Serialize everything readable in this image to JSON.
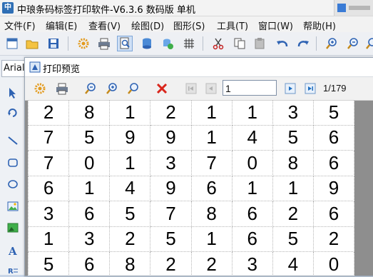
{
  "app": {
    "title": "中琅条码标签打印软件-V6.3.6 数码版 单机",
    "icon_label": "中"
  },
  "menu": [
    "文件(F)",
    "编辑(E)",
    "查看(V)",
    "绘图(D)",
    "图形(S)",
    "工具(T)",
    "窗口(W)",
    "帮助(H)"
  ],
  "font_combo": {
    "value": "Arial"
  },
  "preview": {
    "title": "打印预览",
    "page_input": "1",
    "page_count": "1/179",
    "rows": [
      [
        "2",
        "8",
        "1",
        "2",
        "1",
        "1",
        "3",
        "5"
      ],
      [
        "7",
        "5",
        "9",
        "9",
        "1",
        "4",
        "5",
        "6"
      ],
      [
        "7",
        "0",
        "1",
        "3",
        "7",
        "0",
        "8",
        "6"
      ],
      [
        "6",
        "1",
        "4",
        "9",
        "6",
        "1",
        "1",
        "9"
      ],
      [
        "3",
        "6",
        "5",
        "7",
        "8",
        "6",
        "2",
        "6"
      ],
      [
        "1",
        "3",
        "2",
        "5",
        "1",
        "6",
        "5",
        "2"
      ],
      [
        "5",
        "6",
        "8",
        "2",
        "2",
        "3",
        "4",
        "0"
      ]
    ]
  },
  "colors": {
    "accent_blue": "#2f6fb5",
    "close_red": "#d9261c",
    "canvas_gray": "#8e8e8e"
  }
}
